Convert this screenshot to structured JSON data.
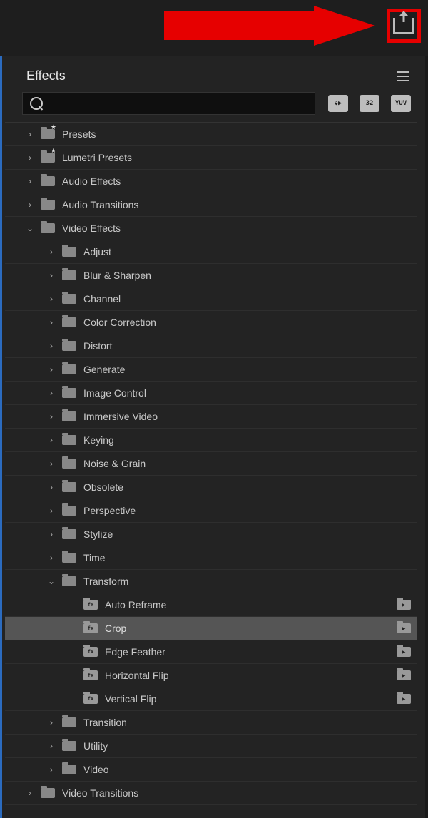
{
  "panel": {
    "title": "Effects"
  },
  "search": {
    "placeholder": ""
  },
  "filters": [
    {
      "name": "fx-type-filter",
      "text": "⬙▶"
    },
    {
      "name": "32bit-filter",
      "text": "32"
    },
    {
      "name": "yuv-filter",
      "text": "YUV"
    }
  ],
  "tree": [
    {
      "level": 0,
      "expanded": false,
      "icon": "folder-star",
      "label": "Presets"
    },
    {
      "level": 0,
      "expanded": false,
      "icon": "folder-star",
      "label": "Lumetri Presets"
    },
    {
      "level": 0,
      "expanded": false,
      "icon": "folder",
      "label": "Audio Effects"
    },
    {
      "level": 0,
      "expanded": false,
      "icon": "folder",
      "label": "Audio Transitions"
    },
    {
      "level": 0,
      "expanded": true,
      "icon": "folder",
      "label": "Video Effects"
    },
    {
      "level": 1,
      "expanded": false,
      "icon": "folder",
      "label": "Adjust"
    },
    {
      "level": 1,
      "expanded": false,
      "icon": "folder",
      "label": "Blur & Sharpen"
    },
    {
      "level": 1,
      "expanded": false,
      "icon": "folder",
      "label": "Channel"
    },
    {
      "level": 1,
      "expanded": false,
      "icon": "folder",
      "label": "Color Correction"
    },
    {
      "level": 1,
      "expanded": false,
      "icon": "folder",
      "label": "Distort"
    },
    {
      "level": 1,
      "expanded": false,
      "icon": "folder",
      "label": "Generate"
    },
    {
      "level": 1,
      "expanded": false,
      "icon": "folder",
      "label": "Image Control"
    },
    {
      "level": 1,
      "expanded": false,
      "icon": "folder",
      "label": "Immersive Video"
    },
    {
      "level": 1,
      "expanded": false,
      "icon": "folder",
      "label": "Keying"
    },
    {
      "level": 1,
      "expanded": false,
      "icon": "folder",
      "label": "Noise & Grain"
    },
    {
      "level": 1,
      "expanded": false,
      "icon": "folder",
      "label": "Obsolete"
    },
    {
      "level": 1,
      "expanded": false,
      "icon": "folder",
      "label": "Perspective"
    },
    {
      "level": 1,
      "expanded": false,
      "icon": "folder",
      "label": "Stylize"
    },
    {
      "level": 1,
      "expanded": false,
      "icon": "folder",
      "label": "Time"
    },
    {
      "level": 1,
      "expanded": true,
      "icon": "folder",
      "label": "Transform"
    },
    {
      "level": 2,
      "icon": "effect",
      "label": "Auto Reframe",
      "accel": true
    },
    {
      "level": 2,
      "icon": "effect",
      "label": "Crop",
      "accel": true,
      "selected": true
    },
    {
      "level": 2,
      "icon": "effect",
      "label": "Edge Feather",
      "accel": true
    },
    {
      "level": 2,
      "icon": "effect",
      "label": "Horizontal Flip",
      "accel": true
    },
    {
      "level": 2,
      "icon": "effect",
      "label": "Vertical Flip",
      "accel": true
    },
    {
      "level": 1,
      "expanded": false,
      "icon": "folder",
      "label": "Transition"
    },
    {
      "level": 1,
      "expanded": false,
      "icon": "folder",
      "label": "Utility"
    },
    {
      "level": 1,
      "expanded": false,
      "icon": "folder",
      "label": "Video"
    },
    {
      "level": 0,
      "expanded": false,
      "icon": "folder",
      "label": "Video Transitions"
    }
  ],
  "annotation": {
    "type": "arrow",
    "target": "export-button",
    "color": "#e60000"
  }
}
